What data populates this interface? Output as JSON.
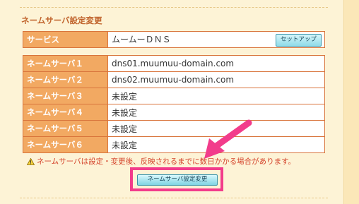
{
  "section_title": "ネームサーバ設定変更",
  "service": {
    "label": "サービス",
    "value": "ムームーＤＮＳ",
    "setup_button": "セットアップ"
  },
  "nameservers": [
    {
      "label": "ネームサーバ１",
      "value": "dns01.muumuu-domain.com"
    },
    {
      "label": "ネームサーバ２",
      "value": "dns02.muumuu-domain.com"
    },
    {
      "label": "ネームサーバ３",
      "value": "未設定"
    },
    {
      "label": "ネームサーバ４",
      "value": "未設定"
    },
    {
      "label": "ネームサーバ５",
      "value": "未設定"
    },
    {
      "label": "ネームサーバ６",
      "value": "未設定"
    }
  ],
  "warning_text": "ネームサーバは設定・変更後、反映されるまでに数日かかる場合があります。",
  "submit_button": "ネームサーバ設定変更",
  "colors": {
    "accent_orange": "#f2a962",
    "highlight_pink": "#f23c8b",
    "warning_red": "#d4422a"
  },
  "icons": [
    "warning-icon",
    "pointer-arrow"
  ]
}
